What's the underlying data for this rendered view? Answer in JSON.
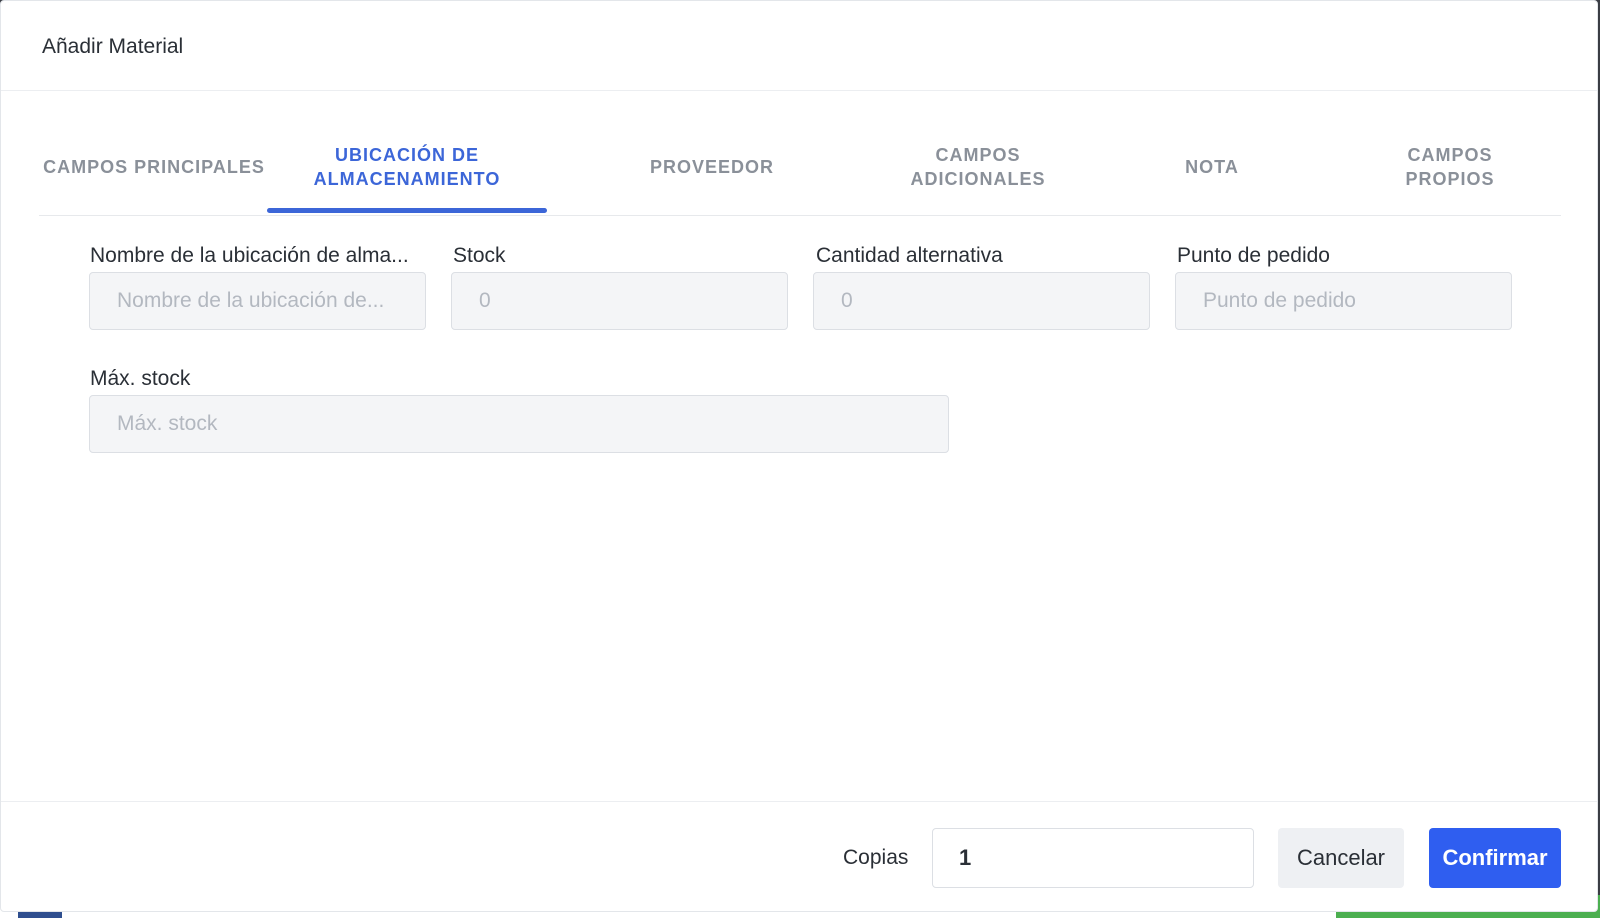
{
  "modal": {
    "title": "Añadir Material"
  },
  "tabs": [
    {
      "label": "CAMPOS PRINCIPALES",
      "active": false
    },
    {
      "label": "UBICACIÓN DE ALMACENAMIENTO",
      "active": true
    },
    {
      "label": "PROVEEDOR",
      "active": false
    },
    {
      "label": "CAMPOS ADICIONALES",
      "active": false
    },
    {
      "label": "NOTA",
      "active": false
    },
    {
      "label": "CAMPOS PROPIOS",
      "active": false
    }
  ],
  "form": {
    "location_name": {
      "label": "Nombre de la ubicación de alma...",
      "placeholder": "Nombre de la ubicación de..."
    },
    "stock": {
      "label": "Stock",
      "placeholder": "0"
    },
    "alt_quantity": {
      "label": "Cantidad alternativa",
      "placeholder": "0"
    },
    "reorder_point": {
      "label": "Punto de pedido",
      "placeholder": "Punto de pedido"
    },
    "max_stock": {
      "label": "Máx. stock",
      "placeholder": "Máx. stock"
    }
  },
  "footer": {
    "copies_label": "Copias",
    "copies_value": "1",
    "cancel_label": "Cancelar",
    "confirm_label": "Confirmar"
  },
  "colors": {
    "accent": "#3c66d8",
    "confirm_button": "#2f5ef0",
    "inactive_tab": "#8a9099"
  }
}
